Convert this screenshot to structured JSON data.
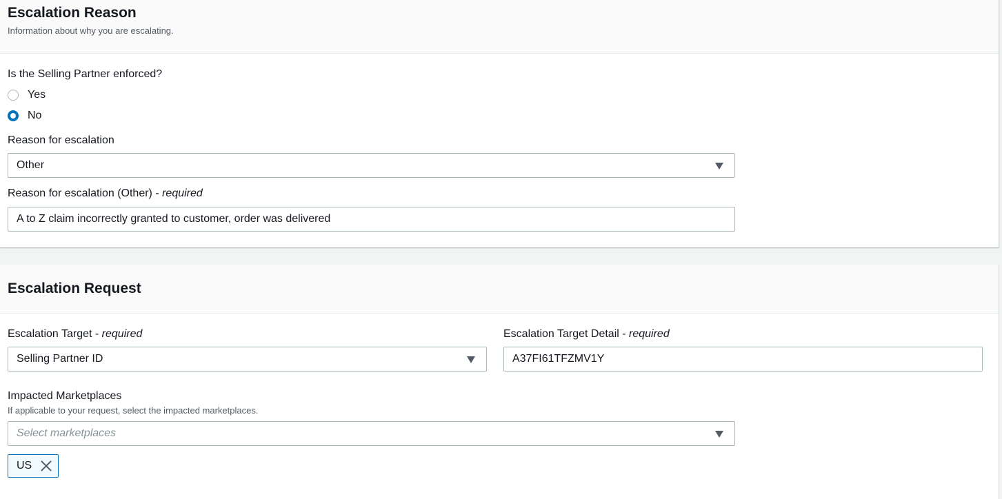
{
  "escalation_reason": {
    "title": "Escalation Reason",
    "description": "Information about why you are escalating.",
    "enforced_question": "Is the Selling Partner enforced?",
    "enforced_options": [
      {
        "label": "Yes",
        "checked": false
      },
      {
        "label": "No",
        "checked": true
      }
    ],
    "reason_label": "Reason for escalation",
    "reason_value": "Other",
    "other_label": "Reason for escalation (Other)",
    "other_required": "required",
    "other_value": "A to Z claim incorrectly granted to customer, order was delivered"
  },
  "escalation_request": {
    "title": "Escalation Request",
    "target_label": "Escalation Target",
    "target_required": "required",
    "target_value": "Selling Partner ID",
    "target_detail_label": "Escalation Target Detail",
    "target_detail_required": "required",
    "target_detail_value": "A37FI61TFZMV1Y",
    "marketplaces_label": "Impacted Marketplaces",
    "marketplaces_description": "If applicable to your request, select the impacted marketplaces.",
    "marketplaces_placeholder": "Select marketplaces",
    "selected_marketplaces": [
      "US"
    ]
  },
  "colors": {
    "accent": "#0073bb",
    "background": "#f2f3f3",
    "header_background": "#fafafa",
    "border": "#aab7b8"
  },
  "icons": {
    "dropdown": "caret-down-icon",
    "remove_token": "close-icon"
  }
}
